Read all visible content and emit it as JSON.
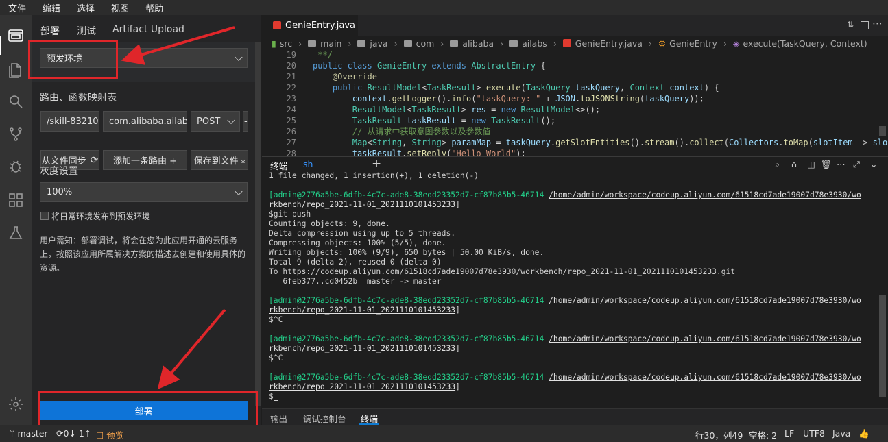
{
  "menu": [
    "文件",
    "编辑",
    "选择",
    "视图",
    "帮助"
  ],
  "side": {
    "tabs": [
      "部署",
      "测试",
      "Artifact Upload"
    ],
    "env_select": "预发环境",
    "route_title": "路由、函数映射表",
    "route_path": "/skill-83210",
    "route_class": "com.alibaba.ailabs",
    "route_method": "POST",
    "route_more": "-",
    "sync_btn": "从文件同步",
    "add_route_btn": "添加一条路由 +",
    "save_btn": "保存到文件",
    "gray_title": "灰度设置",
    "gray_value": "100%",
    "checkbox_label": "将日常环境发布到预发环境",
    "notice": "用户需知：部署调试，将会在您为此应用开通的云服务上，按照该应用所属解决方案的描述去创建和使用具体的资源。",
    "deploy_btn": "部署"
  },
  "editor": {
    "tab": "GenieEntry.java",
    "breadcrumbs": [
      "src",
      "main",
      "java",
      "com",
      "alibaba",
      "ailabs",
      "GenieEntry.java",
      "GenieEntry",
      "execute(TaskQuery, Context)"
    ],
    "line_numbers": [
      "19",
      "20",
      "21",
      "22",
      "23",
      "24",
      "25",
      "26",
      "27",
      "28"
    ]
  },
  "terminal": {
    "tabs": [
      "终端",
      "sh"
    ],
    "lines": [
      "1 file changed, 1 insertion(+), 1 deletion(-)",
      "",
      "",
      "rkbench/repo_2021-11-01_2021110101453233]",
      "$git push",
      "Counting objects: 9, done.",
      "Delta compression using up to 5 threads.",
      "Compressing objects: 100% (5/5), done.",
      "Writing objects: 100% (9/9), 650 bytes | 50.00 KiB/s, done.",
      "Total 9 (delta 2), reused 0 (delta 0)",
      "To https://codeup.aliyun.com/61518cd7ade19007d78e3930/workbench/repo_2021-11-01_2021110101453233.git",
      "   6feb377..cd0452b  master -> master"
    ],
    "prompt_user": "[admin",
    "prompt_host": "@2776a5be-6dfb-4c7c-ade8-38edd23352d7-cf87b85b5-46714",
    "prompt_path": "/home/admin/workspace/codeup.aliyun.com/61518cd7ade19007d78e3930/wo",
    "prompt_path2": "rkbench/repo_2021-11-01_2021110101453233",
    "ctrlc": "$^C",
    "dollar": "$"
  },
  "panel_tabs": [
    "输出",
    "调试控制台",
    "终端"
  ],
  "status": {
    "branch": "master",
    "sync": "0↓ 1↑",
    "preview": "预览",
    "position": "行30，列49",
    "spaces": "空格: 2",
    "eol": "LF",
    "encoding": "UTF8",
    "lang": "Java"
  },
  "colors": {
    "accent": "#0e74d8",
    "highlight_box": "#e0262a"
  }
}
